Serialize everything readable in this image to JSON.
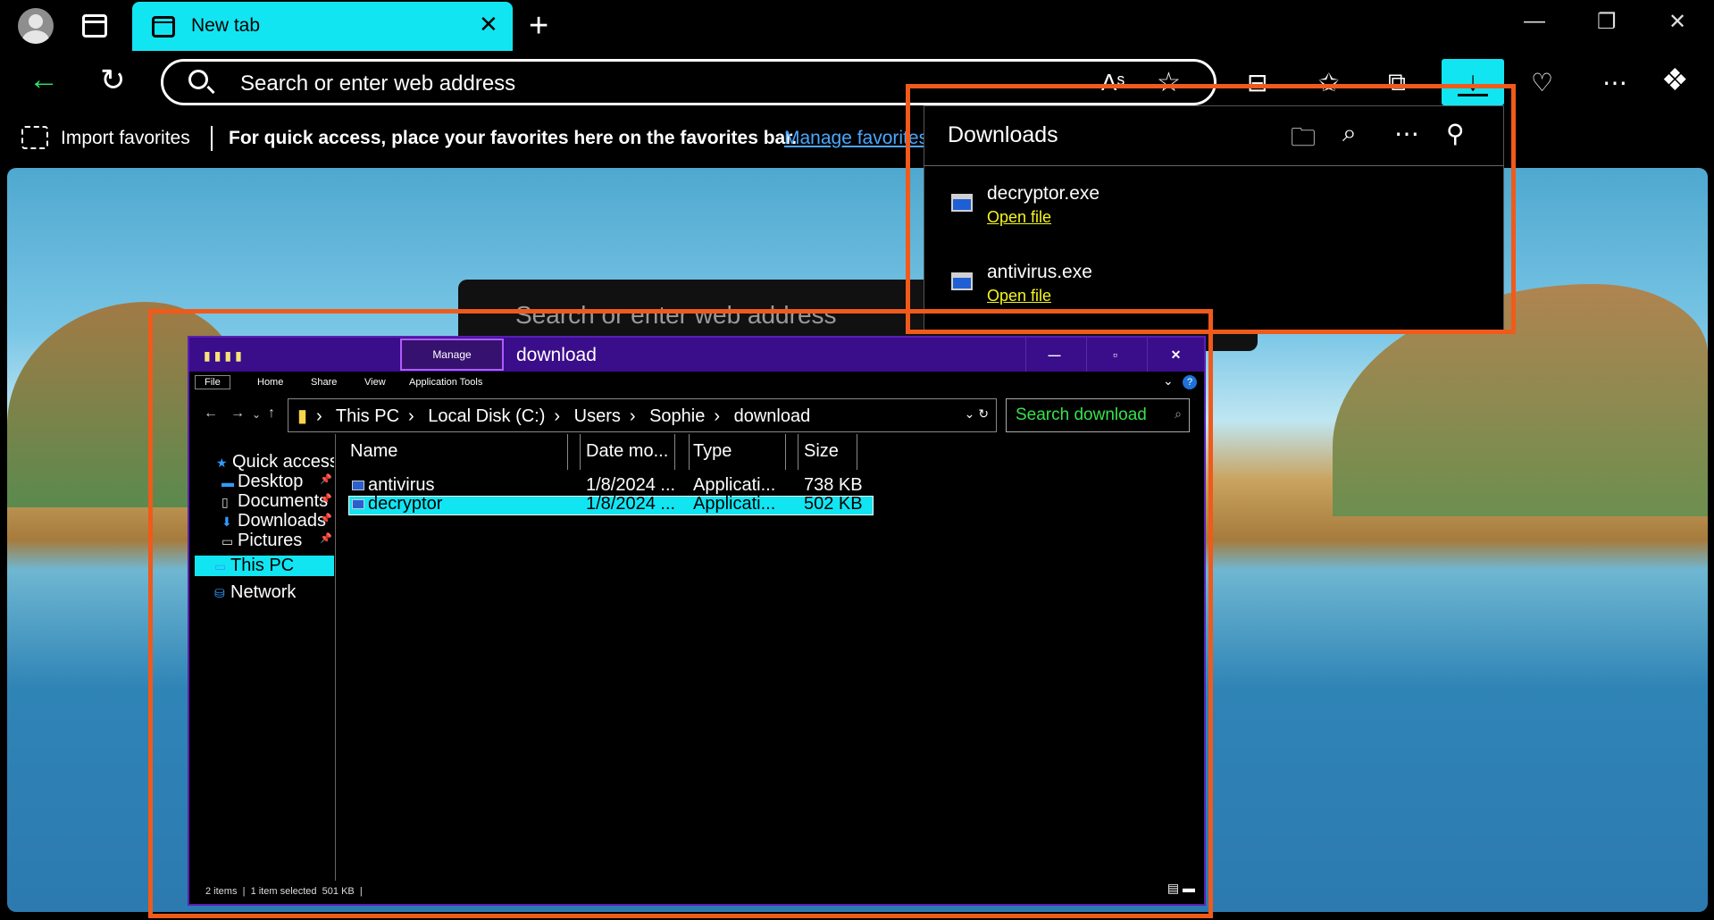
{
  "browser": {
    "tab_title": "New tab",
    "address_placeholder": "Search or enter web address",
    "favorites_bar": {
      "import_label": "Import favorites",
      "message": "For quick access, place your favorites here on the favorites bar.",
      "manage_link": "Manage favorites"
    },
    "ntp_search_placeholder": "Search or enter web address"
  },
  "downloads": {
    "title": "Downloads",
    "items": [
      {
        "name": "decryptor.exe",
        "action": "Open file"
      },
      {
        "name": "antivirus.exe",
        "action": "Open file"
      }
    ]
  },
  "explorer": {
    "window_title": "download",
    "contextual_tab": "Manage",
    "ribbon_tabs": [
      "File",
      "Home",
      "Share",
      "View",
      "Application Tools"
    ],
    "breadcrumbs": [
      "This PC",
      "Local Disk (C:)",
      "Users",
      "Sophie",
      "download"
    ],
    "search_placeholder": "Search download",
    "nav_pane": {
      "quick_access": "Quick access",
      "desktop": "Desktop",
      "documents": "Documents",
      "downloads": "Downloads",
      "pictures": "Pictures",
      "this_pc": "This PC",
      "network": "Network"
    },
    "columns": [
      "Name",
      "Date mo...",
      "Type",
      "Size"
    ],
    "files": [
      {
        "name": "antivirus",
        "date": "1/8/2024 ...",
        "type": "Applicati...",
        "size": "738 KB"
      },
      {
        "name": "decryptor",
        "date": "1/8/2024 ...",
        "type": "Applicati...",
        "size": "502 KB"
      }
    ],
    "status": {
      "count": "2 items",
      "selection": "1 item selected  501 KB"
    }
  },
  "colors": {
    "accent": "#12e5f2",
    "highlight_box": "#f05a1a",
    "explorer_title": "#3a0d8a",
    "link_yellow": "#f5f520",
    "search_green": "#36e24a"
  }
}
